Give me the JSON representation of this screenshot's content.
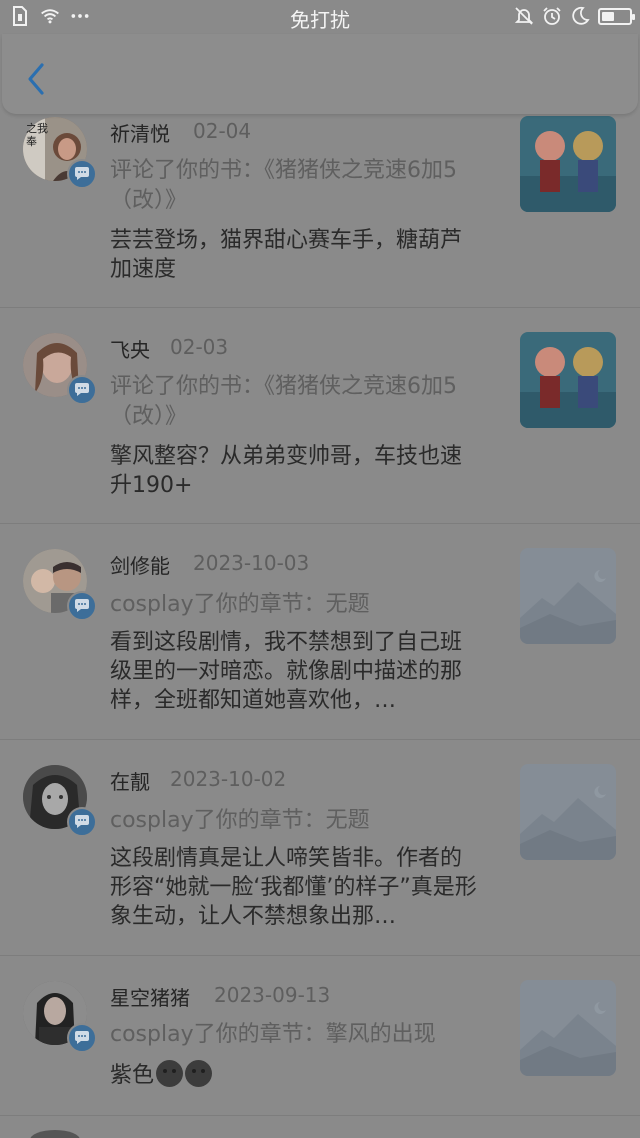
{
  "status_bar": {
    "center_text": "免打扰"
  },
  "notifications": [
    {
      "name": "祈清悦",
      "date": "02-04",
      "action": "评论了你的书：《猪猪侠之竞速6加5（改）》",
      "content": "芸芸登场，猫界甜心赛车手，糖葫芦加速度",
      "avatar_text": "之我\n奉"
    },
    {
      "name": "飞央",
      "date": "02-03",
      "action": "评论了你的书：《猪猪侠之竞速6加5（改）》",
      "content": "擎风整容？从弟弟变帅哥，车技也速升190+"
    },
    {
      "name": "剑修能",
      "date": "2023-10-03",
      "action": "cosplay了你的章节：无题",
      "content": "看到这段剧情，我不禁想到了自己班级里的一对暗恋。就像剧中描述的那样，全班都知道她喜欢他，…"
    },
    {
      "name": "在靓",
      "date": "2023-10-02",
      "action": "cosplay了你的章节：无题",
      "content": "这段剧情真是让人啼笑皆非。作者的形容“她就一脸‘我都懂’的样子”真是形象生动，让人不禁想象出那…"
    },
    {
      "name": "星空猪猪",
      "date": "2023-09-13",
      "action": "cosplay了你的章节：擎风的出现",
      "content": "紫色"
    }
  ],
  "icons": {
    "back": "chevron-left-icon",
    "badge": "comment-bubble-icon",
    "thumb_cartoon": "cartoon-cover-image",
    "thumb_placeholder": "mountain-placeholder-icon"
  },
  "colors": {
    "accent": "#2b6fb0",
    "badge": "#3d6e99",
    "overlay_bg": "#8a8a8a"
  }
}
